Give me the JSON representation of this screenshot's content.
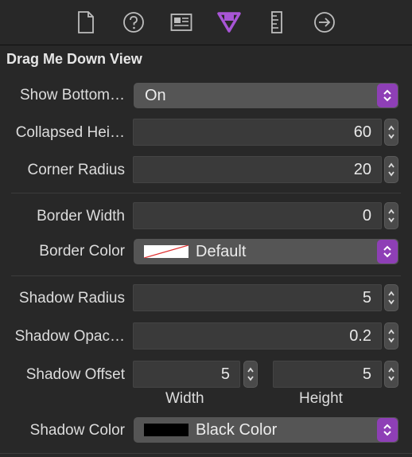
{
  "tabs": [
    {
      "icon": "file-icon",
      "selected": false
    },
    {
      "icon": "help-icon",
      "selected": false
    },
    {
      "icon": "identity-card-icon",
      "selected": false
    },
    {
      "icon": "attributes-down-arrow-icon",
      "selected": true
    },
    {
      "icon": "ruler-icon",
      "selected": false
    },
    {
      "icon": "connections-arrow-icon",
      "selected": false
    }
  ],
  "colors": {
    "accent": "#8e3fb6",
    "background": "#282828",
    "field": "#3a3a3a",
    "popup": "#555555"
  },
  "section": {
    "title": "Drag Me Down View"
  },
  "fields": {
    "show_bottom": {
      "label": "Show Bottom…",
      "value": "On"
    },
    "collapsed_height": {
      "label": "Collapsed Hei…",
      "value": "60"
    },
    "corner_radius": {
      "label": "Corner Radius",
      "value": "20"
    },
    "border_width": {
      "label": "Border Width",
      "value": "0"
    },
    "border_color": {
      "label": "Border Color",
      "value": "Default"
    },
    "shadow_radius": {
      "label": "Shadow Radius",
      "value": "5"
    },
    "shadow_opacity": {
      "label": "Shadow Opac…",
      "value": "0.2"
    },
    "shadow_offset": {
      "label": "Shadow Offset",
      "width": "5",
      "height": "5",
      "width_label": "Width",
      "height_label": "Height"
    },
    "shadow_color": {
      "label": "Shadow Color",
      "value": "Black Color"
    }
  }
}
